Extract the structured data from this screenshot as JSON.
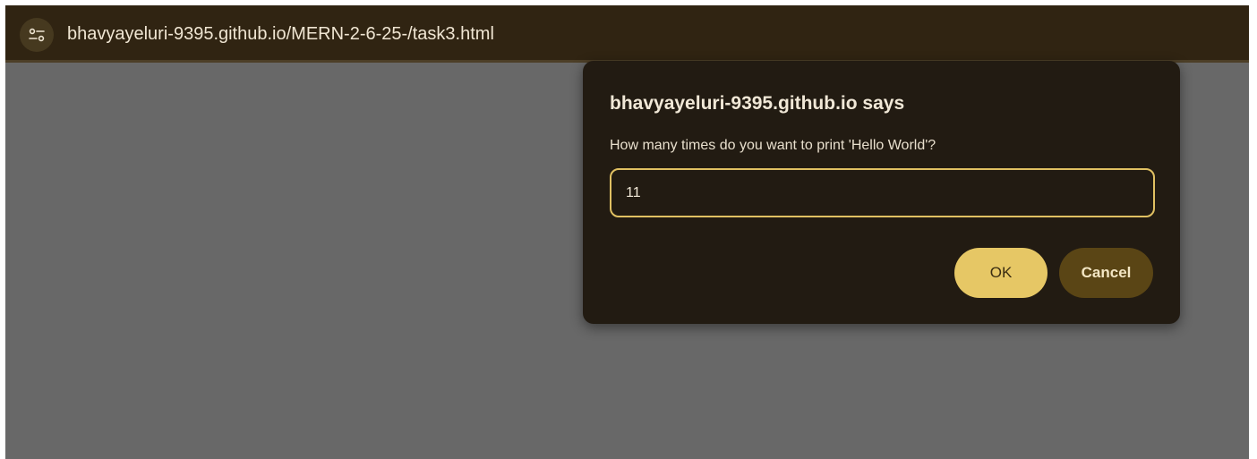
{
  "browser": {
    "url": "bhavyayeluri-9395.github.io/MERN-2-6-25-/task3.html",
    "site_info_icon": "tune-icon"
  },
  "dialog": {
    "title": "bhavyayeluri-9395.github.io says",
    "message": "How many times do you want to print 'Hello World'?",
    "input_value": "11",
    "ok_label": "OK",
    "cancel_label": "Cancel"
  },
  "colors": {
    "toolbar": "#302412",
    "page_overlay": "#686868",
    "dialog_background": "#221b12",
    "accent": "#e6c765",
    "cancel_button": "#5a4515"
  }
}
